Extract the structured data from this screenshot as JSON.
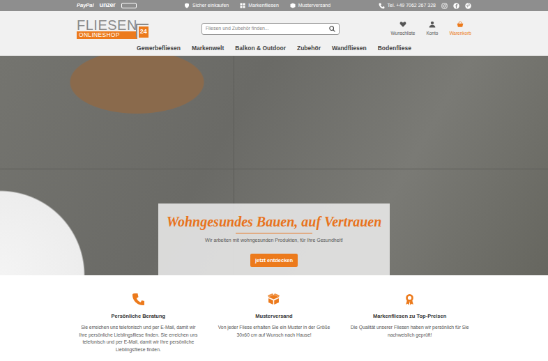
{
  "top_bar": {
    "payment_logos": [
      "PayPal",
      "unzer"
    ],
    "features": [
      "Sicher einkaufen",
      "Markenfliesen",
      "Musterversand"
    ],
    "phone": "Tel. +49 7062 267 328"
  },
  "logo": {
    "main": "FLIESEN",
    "sub": "ONLINESHOP",
    "badge": "24"
  },
  "search": {
    "placeholder": "Fliesen und Zubehör finden..."
  },
  "header_actions": [
    {
      "label": "Wunschliste",
      "highlighted": false
    },
    {
      "label": "Konto",
      "highlighted": false
    },
    {
      "label": "Warenkorb",
      "highlighted": true
    }
  ],
  "nav": {
    "items": [
      "Gewerbefliesen",
      "Markenwelt",
      "Balkon & Outdoor",
      "Zubehör",
      "Wandfliesen",
      "Bodenfliese"
    ]
  },
  "hero": {
    "title": "Wohngesundes Bauen, auf Vertrauen",
    "subtitle": "Wir arbeiten mit wohngesunden Produkten, für Ihre Gesundheit!",
    "button": "jetzt entdecken"
  },
  "features": [
    {
      "title": "Persönliche Beratung",
      "text": "Sie erreichen uns telefonisch und per E-Mail, damit wir Ihre persönliche Lieblingsfliese finden. Sie erreichen uns telefonisch und per E-Mail, damit wir Ihre persönliche Lieblingsfliese finden."
    },
    {
      "title": "Musterversand",
      "text": "Von jeder Fliese erhalten Sie ein Muster in der Größe 30x60 cm auf Wunsch nach Hause!"
    },
    {
      "title": "Markenfliesen zu Top-Preisen",
      "text": "Die Qualität unserer Fliesen haben wir persönlich für Sie nachweislich geprüft!"
    }
  ]
}
